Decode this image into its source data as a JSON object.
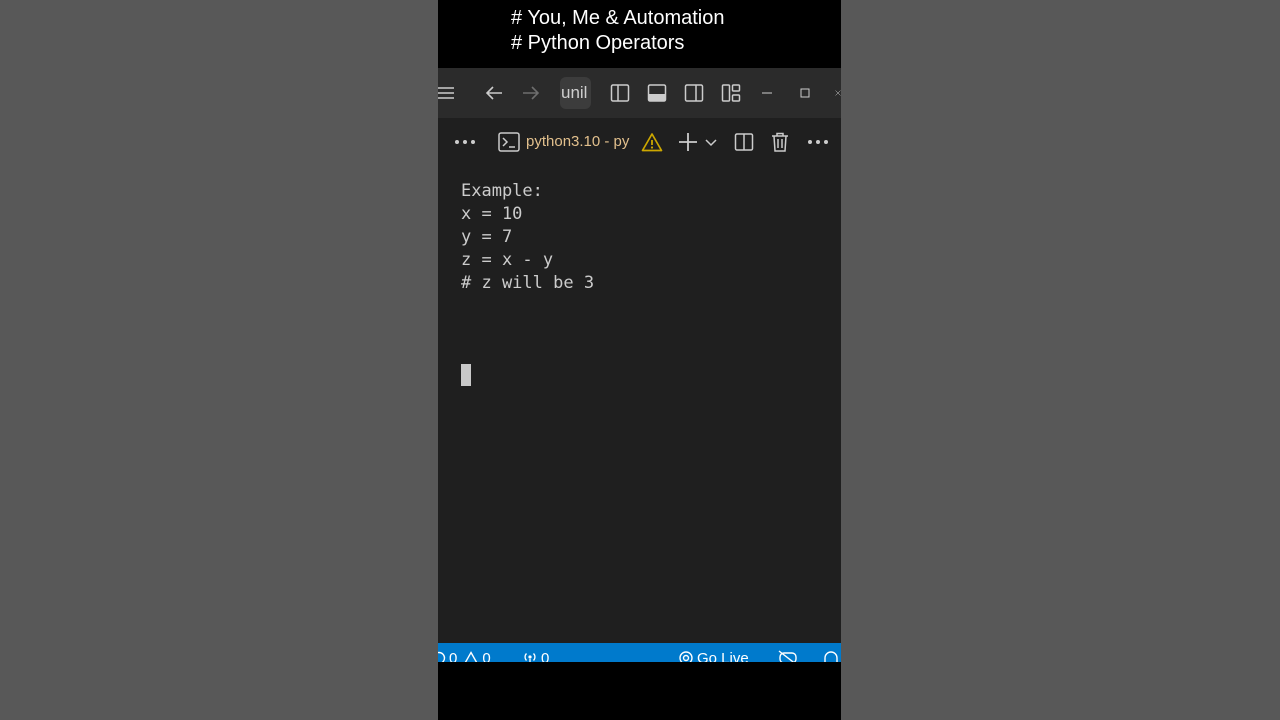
{
  "overlay": {
    "line1": "# You, Me & Automation",
    "line2": "# Python Operators"
  },
  "titlebar": {
    "search_text": "unil",
    "icons": [
      "menu-icon",
      "back-arrow-icon",
      "forward-arrow-icon",
      "toggle-primary-sidebar-icon",
      "toggle-panel-icon",
      "toggle-secondary-sidebar-icon",
      "customize-layout-icon",
      "minimize-icon",
      "maximize-icon",
      "close-icon"
    ]
  },
  "panel": {
    "terminal_label": "python3.10 - py",
    "icons": [
      "more-icon",
      "terminal-icon",
      "warning-icon",
      "new-terminal-icon",
      "chevron-down-icon",
      "split-terminal-icon",
      "trash-icon",
      "more-actions-icon"
    ],
    "warning_color": "#cca700"
  },
  "editor": {
    "lines": [
      "Example:",
      "",
      "x = 10",
      "y = 7",
      "z = x - y",
      "",
      "# z will be 3"
    ]
  },
  "statusbar": {
    "errors": "0",
    "warnings": "0",
    "ports": "0",
    "go_live": "Go Live",
    "accent": "#007acc"
  }
}
